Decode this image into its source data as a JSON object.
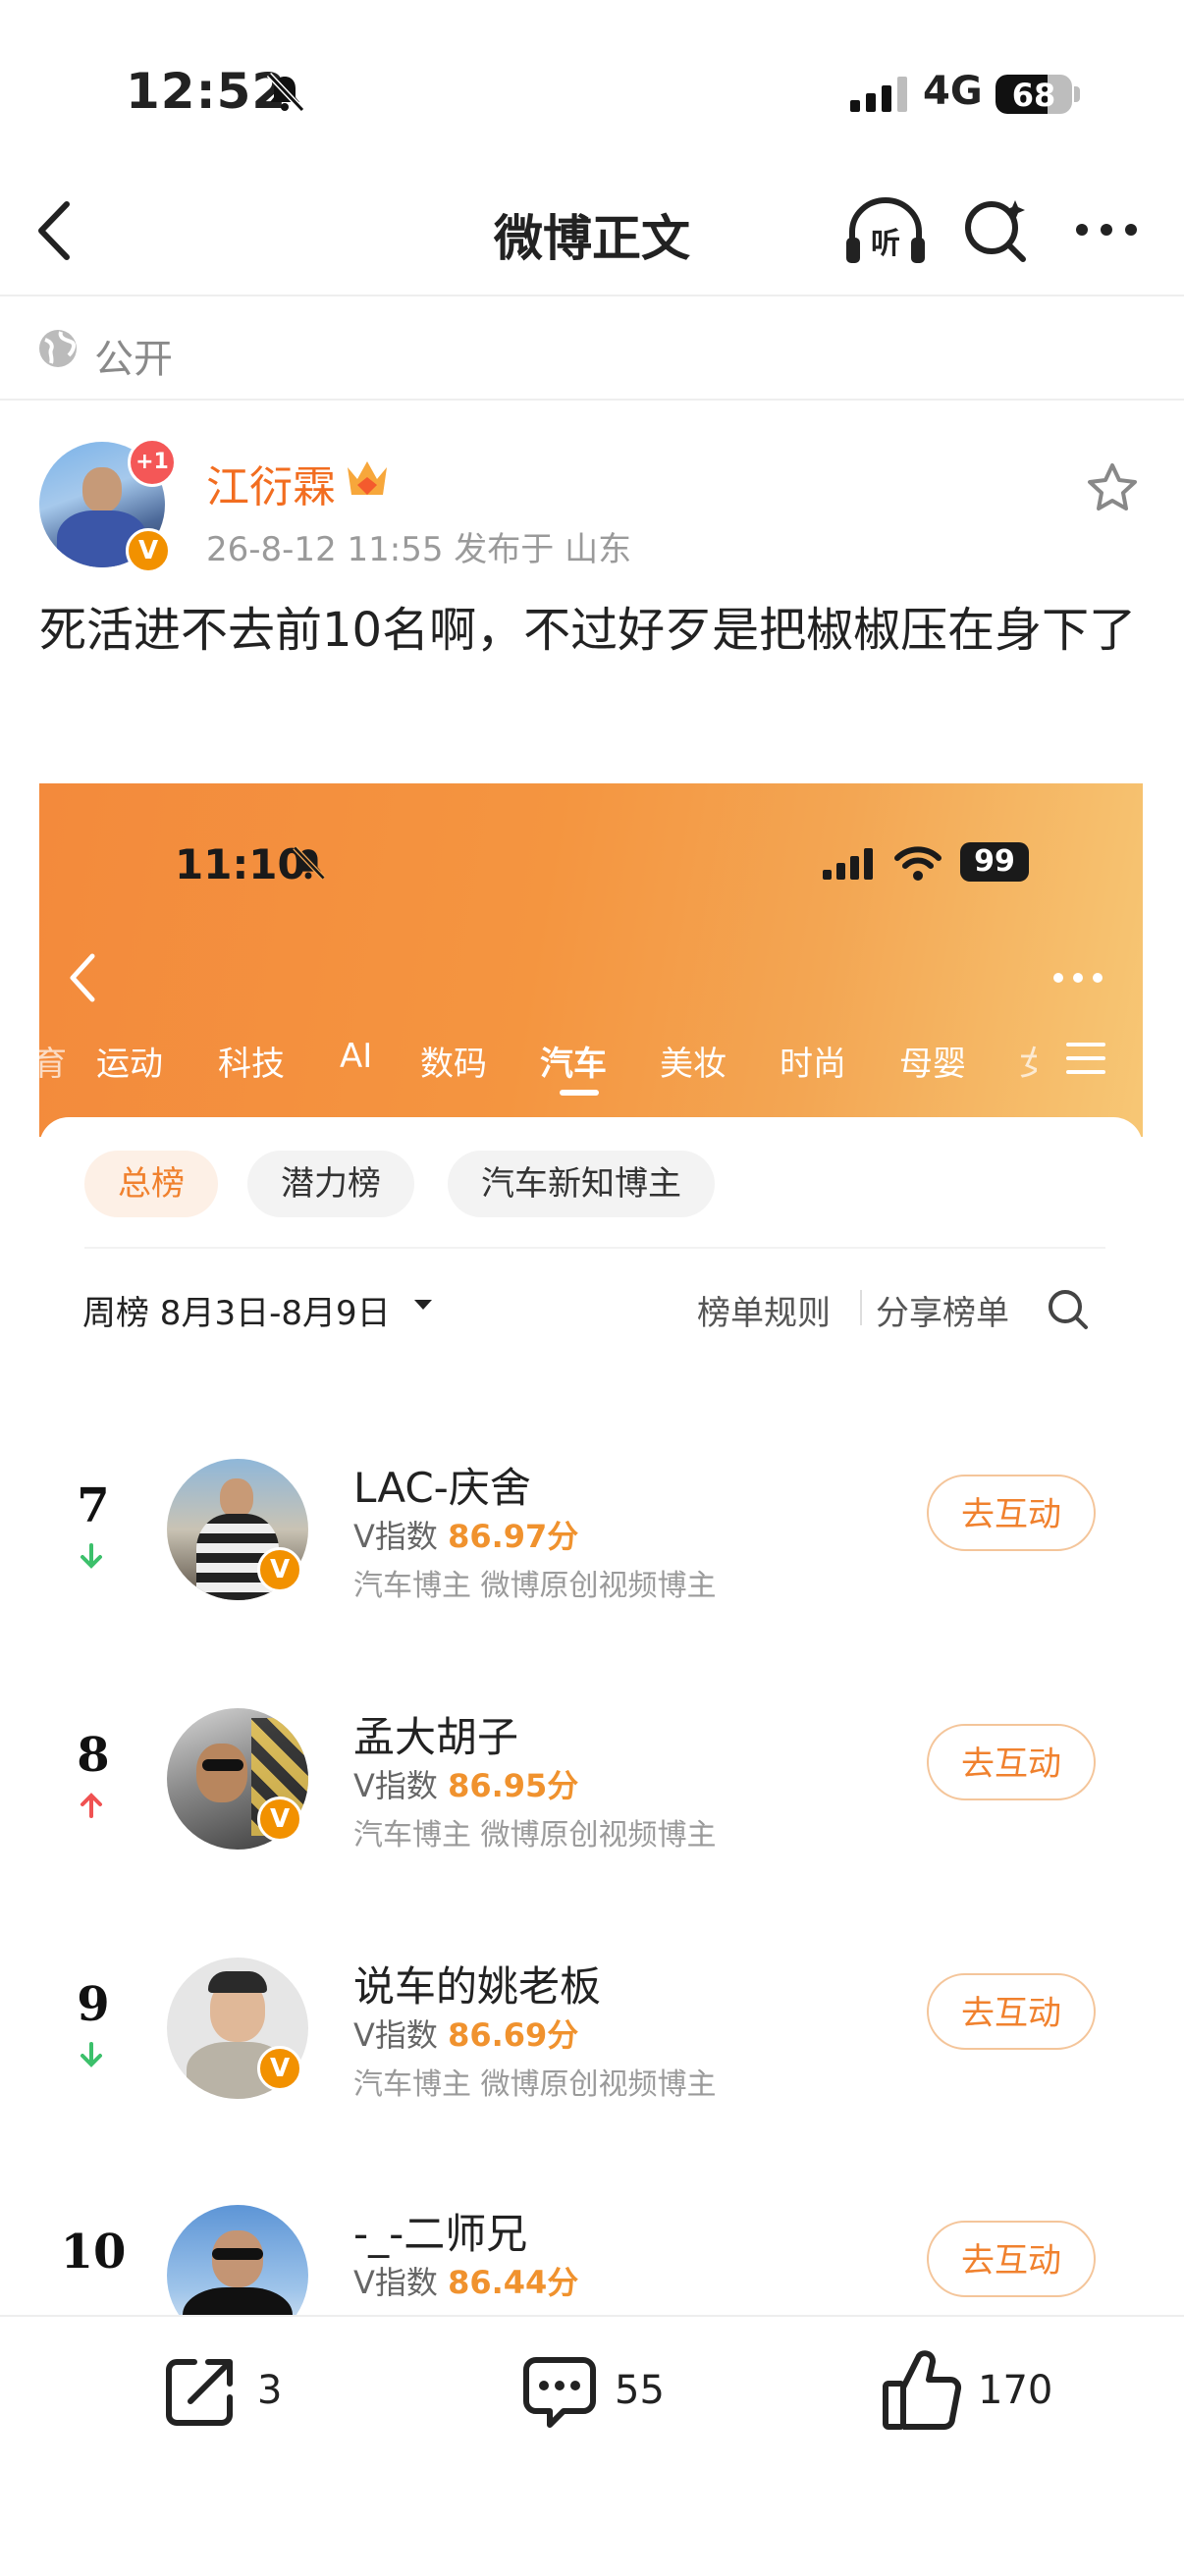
{
  "status_bar": {
    "time": "12:52",
    "network": "4G",
    "battery": "68"
  },
  "nav": {
    "title": "微博正文"
  },
  "visibility": {
    "label": "公开"
  },
  "post": {
    "author": "江衍霖",
    "notif_badge": "+1",
    "meta": "26-8-12 11:55  发布于 山东",
    "text": "死活进不去前10名啊，不过好歹是把椒椒压在身下了"
  },
  "screenshot": {
    "status": {
      "time": "11:10",
      "battery": "99"
    },
    "categories": [
      "运动",
      "科技",
      "AI",
      "数码",
      "汽车",
      "美妆",
      "时尚",
      "母婴",
      "女"
    ],
    "active_category": "汽车",
    "chips": [
      "总榜",
      "潜力榜",
      "汽车新知博主"
    ],
    "week_label": "周榜 8月3日-8月9日",
    "rules_label": "榜单规则",
    "share_label": "分享榜单",
    "rankings": [
      {
        "rank": "7",
        "trend": "down",
        "name": "LAC-庆舍",
        "score_label": "V指数",
        "score": "86.97分",
        "tags": "汽车博主 微博原创视频博主",
        "button": "去互动"
      },
      {
        "rank": "8",
        "trend": "up",
        "name": "孟大胡子",
        "score_label": "V指数",
        "score": "86.95分",
        "tags": "汽车博主 微博原创视频博主",
        "button": "去互动"
      },
      {
        "rank": "9",
        "trend": "down",
        "name": "说车的姚老板",
        "score_label": "V指数",
        "score": "86.69分",
        "tags": "汽车博主 微博原创视频博主",
        "button": "去互动"
      },
      {
        "rank": "10",
        "trend": "",
        "name": "-_-二师兄",
        "score_label": "V指数",
        "score": "86.44分",
        "tags": "",
        "button": "去互动"
      }
    ]
  },
  "actions": {
    "share_count": "3",
    "comment_count": "55",
    "like_count": "170"
  },
  "colors": {
    "accent": "#f26d20",
    "orange_header": "#f38a3c",
    "up": "#f05252",
    "down": "#3cc06b"
  }
}
